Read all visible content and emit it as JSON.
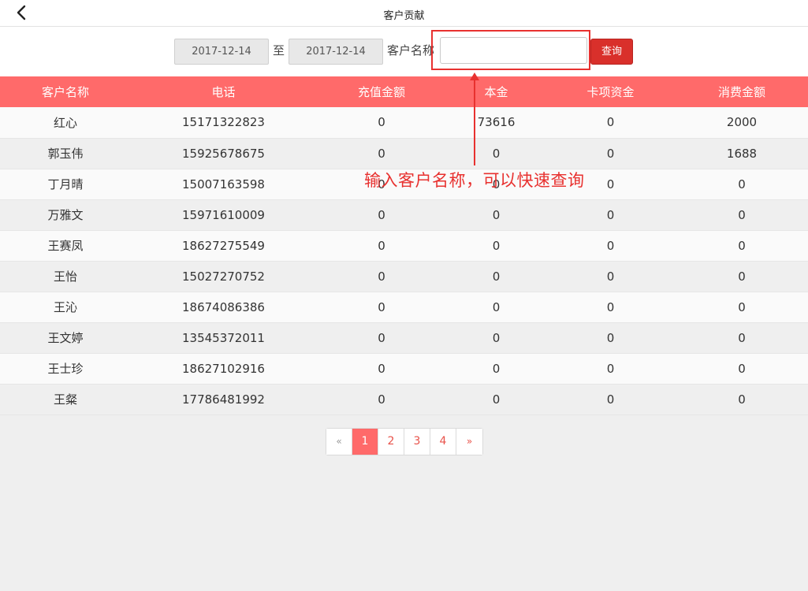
{
  "header": {
    "title": "客户贡献",
    "back_icon": "chevron-left-icon"
  },
  "filter": {
    "start_date": "2017-12-14",
    "to_label": "至",
    "end_date": "2017-12-14",
    "name_label": "客户名称",
    "name_value": "",
    "query_label": "查询"
  },
  "table": {
    "columns": [
      "客户名称",
      "电话",
      "充值金额",
      "本金",
      "卡项资金",
      "消费金额"
    ],
    "rows": [
      [
        "红心",
        "15171322823",
        "0",
        "73616",
        "0",
        "2000"
      ],
      [
        "郭玉伟",
        "15925678675",
        "0",
        "0",
        "0",
        "1688"
      ],
      [
        "丁月晴",
        "15007163598",
        "0",
        "0",
        "0",
        "0"
      ],
      [
        "万雅文",
        "15971610009",
        "0",
        "0",
        "0",
        "0"
      ],
      [
        "王赛凤",
        "18627275549",
        "0",
        "0",
        "0",
        "0"
      ],
      [
        "王怡",
        "15027270752",
        "0",
        "0",
        "0",
        "0"
      ],
      [
        "王沁",
        "18674086386",
        "0",
        "0",
        "0",
        "0"
      ],
      [
        "王文婷",
        "13545372011",
        "0",
        "0",
        "0",
        "0"
      ],
      [
        "王士珍",
        "18627102916",
        "0",
        "0",
        "0",
        "0"
      ],
      [
        "王粲",
        "17786481992",
        "0",
        "0",
        "0",
        "0"
      ]
    ]
  },
  "annotation": {
    "text": "输入客户名称，可以快速查询",
    "color": "#e8312f"
  },
  "pagination": {
    "prev": "«",
    "pages": [
      "1",
      "2",
      "3",
      "4"
    ],
    "active": "1",
    "next": "»"
  },
  "colors": {
    "header_row": "#ff6a6a",
    "button": "#d9302b",
    "accent": "#e8524a"
  }
}
